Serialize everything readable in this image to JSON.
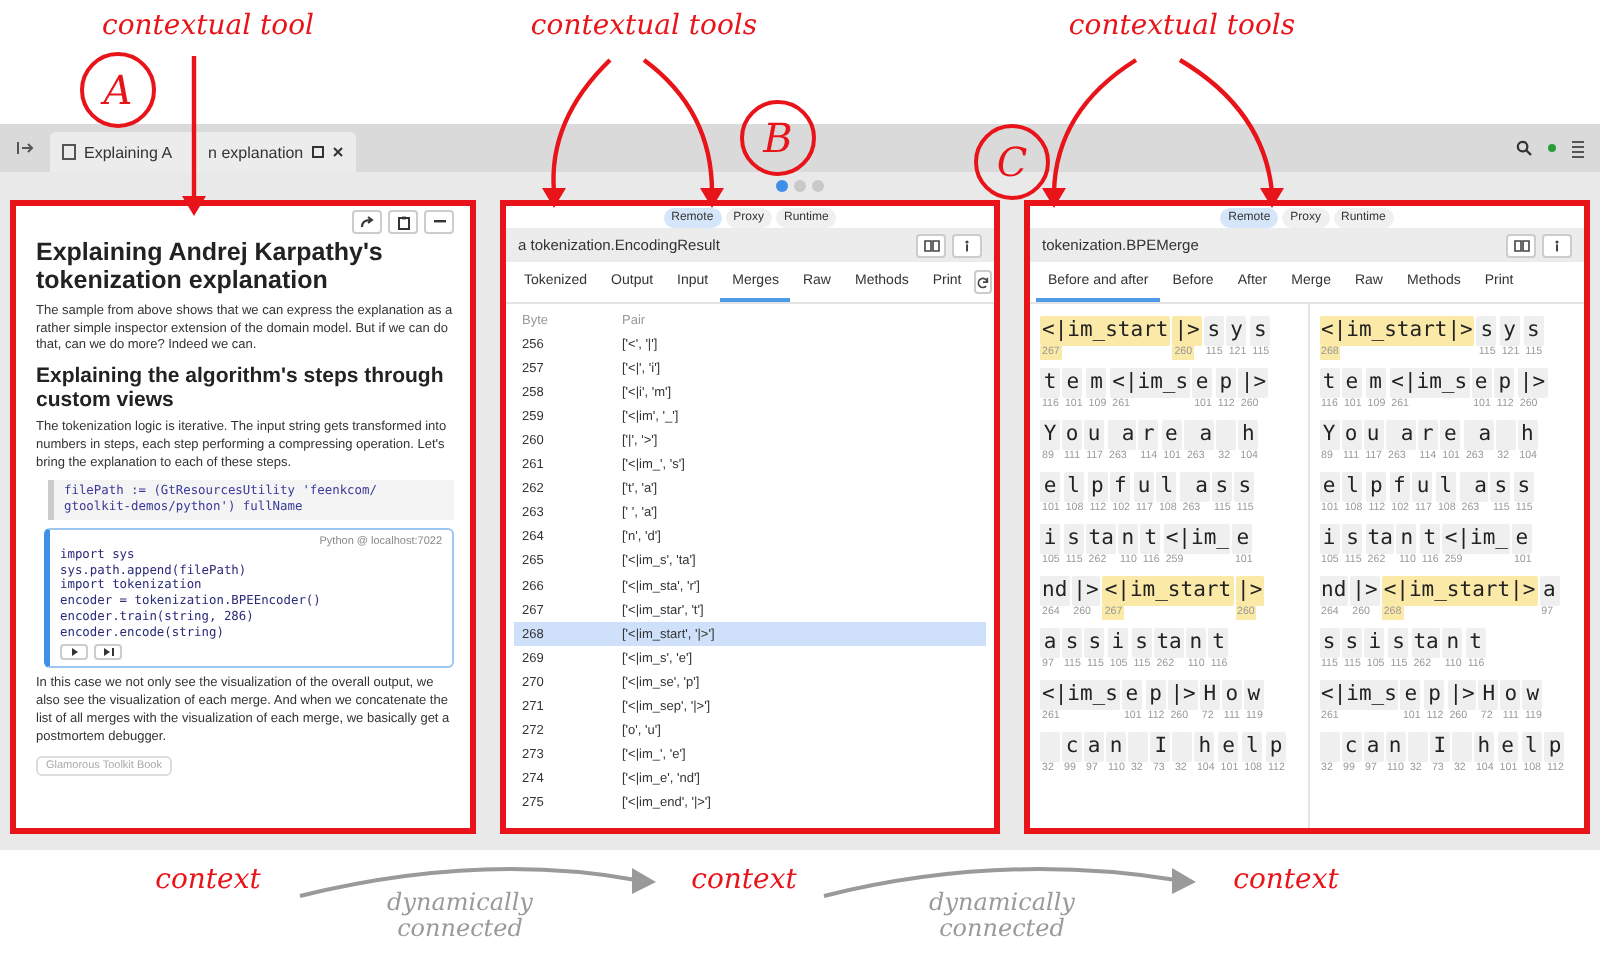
{
  "annotations": {
    "top_labels": [
      "contextual tool",
      "contextual tools",
      "contextual tools"
    ],
    "circle_labels": [
      "A",
      "B",
      "C"
    ],
    "bottom_labels": [
      "context",
      "context",
      "context"
    ],
    "connector_labels": [
      "dynamically connected",
      "dynamically connected"
    ]
  },
  "window": {
    "tab": {
      "title_parts": [
        "Explaining A",
        "n explanation"
      ]
    },
    "page_dots": [
      {
        "selected": true
      },
      {
        "selected": false
      },
      {
        "selected": false
      }
    ]
  },
  "pane_a": {
    "title": "Explaining Andrej Karpathy's tokenization explanation",
    "intro": "The sample from above shows that we can express the explanation as a rather simple inspector extension of the domain model. But if we can do that, can we do more? Indeed we can.",
    "heading": "Explaining the algorithm's steps through custom views",
    "paragraph": "The tokenization logic is iterative. The input string gets transformed into numbers in steps, each step performing a compressing operation. Let's bring the explanation to each of these steps.",
    "snippet_lines": [
      "filePath := (GtResourcesUtility 'feenkcom/",
      "gtoolkit-demos/python') fullName"
    ],
    "python": {
      "label": "Python @ localhost:7022",
      "lines": [
        "import sys",
        "sys.path.append(filePath)",
        "import tokenization",
        "encoder = tokenization.BPEEncoder()",
        "encoder.train(string, 286)",
        "encoder.encode(string)"
      ]
    },
    "closing": "In this case we not only see the visualization of the overall output, we also see the visualization of each merge. And when we concatenate the list of all merges with the visualization of each merge, we basically get a postmortem debugger.",
    "book_tag": "Glamorous Toolkit Book"
  },
  "pane_b": {
    "chips": [
      {
        "label": "Remote",
        "selected": true
      },
      {
        "label": "Proxy",
        "selected": false
      },
      {
        "label": "Runtime",
        "selected": false
      }
    ],
    "title": "a tokenization.EncodingResult",
    "tabs": [
      {
        "label": "Tokenized",
        "selected": false
      },
      {
        "label": "Output",
        "selected": false
      },
      {
        "label": "Input",
        "selected": false
      },
      {
        "label": "Merges",
        "selected": true
      },
      {
        "label": "Raw",
        "selected": false
      },
      {
        "label": "Methods",
        "selected": false
      },
      {
        "label": "Print",
        "selected": false
      }
    ],
    "table": {
      "columns": [
        "Byte",
        "Pair"
      ],
      "rows": [
        {
          "byte": "256",
          "pair": "['<', '|']",
          "selected": false
        },
        {
          "byte": "257",
          "pair": "['<|', 'i']",
          "selected": false
        },
        {
          "byte": "258",
          "pair": "['<|i', 'm']",
          "selected": false
        },
        {
          "byte": "259",
          "pair": "['<|im', '_']",
          "selected": false
        },
        {
          "byte": "260",
          "pair": "['|', '>']",
          "selected": false
        },
        {
          "byte": "261",
          "pair": "['<|im_', 's']",
          "selected": false
        },
        {
          "byte": "262",
          "pair": "['t', 'a']",
          "selected": false
        },
        {
          "byte": "263",
          "pair": "[' ', 'a']",
          "selected": false
        },
        {
          "byte": "264",
          "pair": "['n', 'd']",
          "selected": false
        },
        {
          "byte": "265",
          "pair": "['<|im_s', 'ta']",
          "selected": false
        },
        {
          "byte": "266",
          "pair": "['<|im_sta', 'r']",
          "selected": false
        },
        {
          "byte": "267",
          "pair": "['<|im_star', 't']",
          "selected": false
        },
        {
          "byte": "268",
          "pair": "['<|im_start', '|>']",
          "selected": true
        },
        {
          "byte": "269",
          "pair": "['<|im_s', 'e']",
          "selected": false
        },
        {
          "byte": "270",
          "pair": "['<|im_se', 'p']",
          "selected": false
        },
        {
          "byte": "271",
          "pair": "['<|im_sep', '|>']",
          "selected": false
        },
        {
          "byte": "272",
          "pair": "['o', 'u']",
          "selected": false
        },
        {
          "byte": "273",
          "pair": "['<|im_', 'e']",
          "selected": false
        },
        {
          "byte": "274",
          "pair": "['<|im_e', 'nd']",
          "selected": false
        },
        {
          "byte": "275",
          "pair": "['<|im_end', '|>']",
          "selected": false
        }
      ]
    }
  },
  "pane_c": {
    "chips": [
      {
        "label": "Remote",
        "selected": true
      },
      {
        "label": "Proxy",
        "selected": false
      },
      {
        "label": "Runtime",
        "selected": false
      }
    ],
    "title": "tokenization.BPEMerge",
    "tabs": [
      {
        "label": "Before and after",
        "selected": true
      },
      {
        "label": "Before",
        "selected": false
      },
      {
        "label": "After",
        "selected": false
      },
      {
        "label": "Merge",
        "selected": false
      },
      {
        "label": "Raw",
        "selected": false
      },
      {
        "label": "Methods",
        "selected": false
      },
      {
        "label": "Print",
        "selected": false
      }
    ],
    "before": [
      [
        {
          "text": "<|im_start",
          "code": "267",
          "highlighted": true
        },
        {
          "text": "|>",
          "code": "260",
          "highlighted": true
        },
        {
          "text": "s",
          "code": "115",
          "highlighted": false
        },
        {
          "text": "y",
          "code": "121",
          "highlighted": false
        },
        {
          "text": "s",
          "code": "115",
          "highlighted": false
        }
      ],
      [
        {
          "text": "t",
          "code": "116",
          "highlighted": false
        },
        {
          "text": "e",
          "code": "101",
          "highlighted": false
        },
        {
          "text": "m",
          "code": "109",
          "highlighted": false
        },
        {
          "text": "<|im_s",
          "code": "261",
          "highlighted": false
        },
        {
          "text": "e",
          "code": "101",
          "highlighted": false
        },
        {
          "text": "p",
          "code": "112",
          "highlighted": false
        },
        {
          "text": "|>",
          "code": "260",
          "highlighted": false
        }
      ],
      [
        {
          "text": "Y",
          "code": "89",
          "highlighted": false
        },
        {
          "text": "o",
          "code": "111",
          "highlighted": false
        },
        {
          "text": "u",
          "code": "117",
          "highlighted": false
        },
        {
          "text": " a",
          "code": "263",
          "highlighted": false
        },
        {
          "text": "r",
          "code": "114",
          "highlighted": false
        },
        {
          "text": "e",
          "code": "101",
          "highlighted": false
        },
        {
          "text": " a",
          "code": "263",
          "highlighted": false
        },
        {
          "code": "32",
          "highlighted": false
        },
        {
          "text": "h",
          "code": "104",
          "highlighted": false
        }
      ],
      [
        {
          "text": "e",
          "code": "101",
          "highlighted": false
        },
        {
          "text": "l",
          "code": "108",
          "highlighted": false
        },
        {
          "text": "p",
          "code": "112",
          "highlighted": false
        },
        {
          "text": "f",
          "code": "102",
          "highlighted": false
        },
        {
          "text": "u",
          "code": "117",
          "highlighted": false
        },
        {
          "text": "l",
          "code": "108",
          "highlighted": false
        },
        {
          "text": " a",
          "code": "263",
          "highlighted": false
        },
        {
          "text": "s",
          "code": "115",
          "highlighted": false
        },
        {
          "text": "s",
          "code": "115",
          "highlighted": false
        }
      ],
      [
        {
          "text": "i",
          "code": "105",
          "highlighted": false
        },
        {
          "text": "s",
          "code": "115",
          "highlighted": false
        },
        {
          "text": "ta",
          "code": "262",
          "highlighted": false
        },
        {
          "text": "n",
          "code": "110",
          "highlighted": false
        },
        {
          "text": "t",
          "code": "116",
          "highlighted": false
        },
        {
          "text": "<|im_",
          "code": "259",
          "highlighted": false
        },
        {
          "text": "e",
          "code": "101",
          "highlighted": false
        }
      ],
      [
        {
          "text": "nd",
          "code": "264",
          "highlighted": false
        },
        {
          "text": "|>",
          "code": "260",
          "highlighted": false
        },
        {
          "text": "<|im_start",
          "code": "267",
          "highlighted": true
        },
        {
          "text": "|>",
          "code": "260",
          "highlighted": true
        }
      ],
      [
        {
          "text": "a",
          "code": "97",
          "highlighted": false
        },
        {
          "text": "s",
          "code": "115",
          "highlighted": false
        },
        {
          "text": "s",
          "code": "115",
          "highlighted": false
        },
        {
          "text": "i",
          "code": "105",
          "highlighted": false
        },
        {
          "text": "s",
          "code": "115",
          "highlighted": false
        },
        {
          "text": "ta",
          "code": "262",
          "highlighted": false
        },
        {
          "text": "n",
          "code": "110",
          "highlighted": false
        },
        {
          "text": "t",
          "code": "116",
          "highlighted": false
        }
      ],
      [
        {
          "text": "<|im_s",
          "code": "261",
          "highlighted": false
        },
        {
          "text": "e",
          "code": "101",
          "highlighted": false
        },
        {
          "text": "p",
          "code": "112",
          "highlighted": false
        },
        {
          "text": "|>",
          "code": "260",
          "highlighted": false
        },
        {
          "text": "H",
          "code": "72",
          "highlighted": false
        },
        {
          "text": "o",
          "code": "111",
          "highlighted": false
        },
        {
          "text": "w",
          "code": "119",
          "highlighted": false
        }
      ],
      [
        {
          "code": "32",
          "highlighted": false
        },
        {
          "text": "c",
          "code": "99",
          "highlighted": false
        },
        {
          "text": "a",
          "code": "97",
          "highlighted": false
        },
        {
          "text": "n",
          "code": "110",
          "highlighted": false
        },
        {
          "code": "32",
          "highlighted": false
        },
        {
          "text": "I",
          "code": "73",
          "highlighted": false
        },
        {
          "code": "32",
          "highlighted": false
        },
        {
          "text": "h",
          "code": "104",
          "highlighted": false
        },
        {
          "text": "e",
          "code": "101",
          "highlighted": false
        },
        {
          "text": "l",
          "code": "108",
          "highlighted": false
        },
        {
          "text": "p",
          "code": "112",
          "highlighted": false
        }
      ]
    ],
    "after": [
      [
        {
          "text": "<|im_start|>",
          "code": "268",
          "highlighted": true
        },
        {
          "text": "s",
          "code": "115",
          "highlighted": false
        },
        {
          "text": "y",
          "code": "121",
          "highlighted": false
        },
        {
          "text": "s",
          "code": "115",
          "highlighted": false
        }
      ],
      [
        {
          "text": "t",
          "code": "116",
          "highlighted": false
        },
        {
          "text": "e",
          "code": "101",
          "highlighted": false
        },
        {
          "text": "m",
          "code": "109",
          "highlighted": false
        },
        {
          "text": "<|im_s",
          "code": "261",
          "highlighted": false
        },
        {
          "text": "e",
          "code": "101",
          "highlighted": false
        },
        {
          "text": "p",
          "code": "112",
          "highlighted": false
        },
        {
          "text": "|>",
          "code": "260",
          "highlighted": false
        }
      ],
      [
        {
          "text": "Y",
          "code": "89",
          "highlighted": false
        },
        {
          "text": "o",
          "code": "111",
          "highlighted": false
        },
        {
          "text": "u",
          "code": "117",
          "highlighted": false
        },
        {
          "text": " a",
          "code": "263",
          "highlighted": false
        },
        {
          "text": "r",
          "code": "114",
          "highlighted": false
        },
        {
          "text": "e",
          "code": "101",
          "highlighted": false
        },
        {
          "text": " a",
          "code": "263",
          "highlighted": false
        },
        {
          "code": "32",
          "highlighted": false
        },
        {
          "text": "h",
          "code": "104",
          "highlighted": false
        }
      ],
      [
        {
          "text": "e",
          "code": "101",
          "highlighted": false
        },
        {
          "text": "l",
          "code": "108",
          "highlighted": false
        },
        {
          "text": "p",
          "code": "112",
          "highlighted": false
        },
        {
          "text": "f",
          "code": "102",
          "highlighted": false
        },
        {
          "text": "u",
          "code": "117",
          "highlighted": false
        },
        {
          "text": "l",
          "code": "108",
          "highlighted": false
        },
        {
          "text": " a",
          "code": "263",
          "highlighted": false
        },
        {
          "text": "s",
          "code": "115",
          "highlighted": false
        },
        {
          "text": "s",
          "code": "115",
          "highlighted": false
        }
      ],
      [
        {
          "text": "i",
          "code": "105",
          "highlighted": false
        },
        {
          "text": "s",
          "code": "115",
          "highlighted": false
        },
        {
          "text": "ta",
          "code": "262",
          "highlighted": false
        },
        {
          "text": "n",
          "code": "110",
          "highlighted": false
        },
        {
          "text": "t",
          "code": "116",
          "highlighted": false
        },
        {
          "text": "<|im_",
          "code": "259",
          "highlighted": false
        },
        {
          "text": "e",
          "code": "101",
          "highlighted": false
        }
      ],
      [
        {
          "text": "nd",
          "code": "264",
          "highlighted": false
        },
        {
          "text": "|>",
          "code": "260",
          "highlighted": false
        },
        {
          "text": "<|im_start|>",
          "code": "268",
          "highlighted": true
        },
        {
          "text": "a",
          "code": "97",
          "highlighted": false
        }
      ],
      [
        {
          "text": "s",
          "code": "115",
          "highlighted": false
        },
        {
          "text": "s",
          "code": "115",
          "highlighted": false
        },
        {
          "text": "i",
          "code": "105",
          "highlighted": false
        },
        {
          "text": "s",
          "code": "115",
          "highlighted": false
        },
        {
          "text": "ta",
          "code": "262",
          "highlighted": false
        },
        {
          "text": "n",
          "code": "110",
          "highlighted": false
        },
        {
          "text": "t",
          "code": "116",
          "highlighted": false
        }
      ],
      [
        {
          "text": "<|im_s",
          "code": "261",
          "highlighted": false
        },
        {
          "text": "e",
          "code": "101",
          "highlighted": false
        },
        {
          "text": "p",
          "code": "112",
          "highlighted": false
        },
        {
          "text": "|>",
          "code": "260",
          "highlighted": false
        },
        {
          "text": "H",
          "code": "72",
          "highlighted": false
        },
        {
          "text": "o",
          "code": "111",
          "highlighted": false
        },
        {
          "text": "w",
          "code": "119",
          "highlighted": false
        }
      ],
      [
        {
          "code": "32",
          "highlighted": false
        },
        {
          "text": "c",
          "code": "99",
          "highlighted": false
        },
        {
          "text": "a",
          "code": "97",
          "highlighted": false
        },
        {
          "text": "n",
          "code": "110",
          "highlighted": false
        },
        {
          "code": "32",
          "highlighted": false
        },
        {
          "text": "I",
          "code": "73",
          "highlighted": false
        },
        {
          "code": "32",
          "highlighted": false
        },
        {
          "text": "h",
          "code": "104",
          "highlighted": false
        },
        {
          "text": "e",
          "code": "101",
          "highlighted": false
        },
        {
          "text": "l",
          "code": "108",
          "highlighted": false
        },
        {
          "text": "p",
          "code": "112",
          "highlighted": false
        }
      ]
    ]
  }
}
